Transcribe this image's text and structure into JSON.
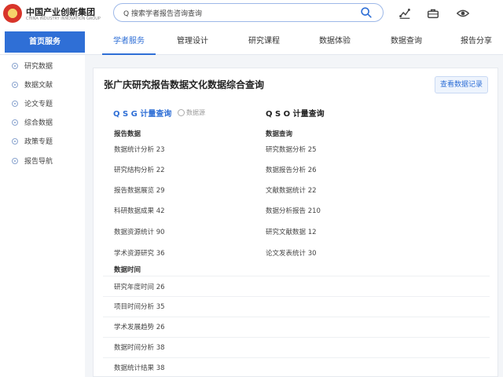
{
  "header": {
    "site_title": "中国产业创新集团",
    "site_subtitle": "CHINA INDUSTRY INNOVATION GROUP",
    "search": {
      "value": "Q 搜索学者报告咨询查询"
    },
    "icons": [
      "analytics-icon",
      "briefcase-icon",
      "eye-icon"
    ]
  },
  "nav": {
    "home": "首页服务",
    "tabs": [
      {
        "label": "学者服务",
        "active": true
      },
      {
        "label": "管理设计"
      },
      {
        "label": "研究课程"
      },
      {
        "label": "数据体验"
      },
      {
        "label": "数据查询"
      },
      {
        "label": "报告分享"
      }
    ]
  },
  "sidebar": {
    "items": [
      {
        "label": "研究数据"
      },
      {
        "label": "数据文献"
      },
      {
        "label": "论文专题"
      },
      {
        "label": "综合数据"
      },
      {
        "label": "政策专题"
      },
      {
        "label": "报告导航"
      }
    ]
  },
  "main": {
    "title": "张广庆研究报告数据文化数据综合查询",
    "apply_button": "查看数据记录",
    "left": {
      "heading": "Q S G 计量查询",
      "tag": "数据源",
      "section1_label": "报告数据",
      "section1_rows": [
        "数据统计分析 23",
        "研究结构分析 22",
        "报告数据展览 29",
        "科研数据成果 42",
        "数据资源统计 90",
        "学术资源研究 36"
      ],
      "section2_label": "数据时间",
      "section2_rows": [
        "研究年度时间 26",
        "项目时间分析 35",
        "学术发展趋势 26",
        "数据时间分析 38",
        "数据统计结果 38"
      ]
    },
    "right": {
      "heading": "Q S O 计量查询",
      "section1_label": "数据查询",
      "rows": [
        "研究数据分析 25",
        "数据报告分析 26",
        "文献数据统计 22",
        "数据分析报告 210",
        "研究文献数据 12",
        "论文发表统计 30"
      ]
    }
  }
}
